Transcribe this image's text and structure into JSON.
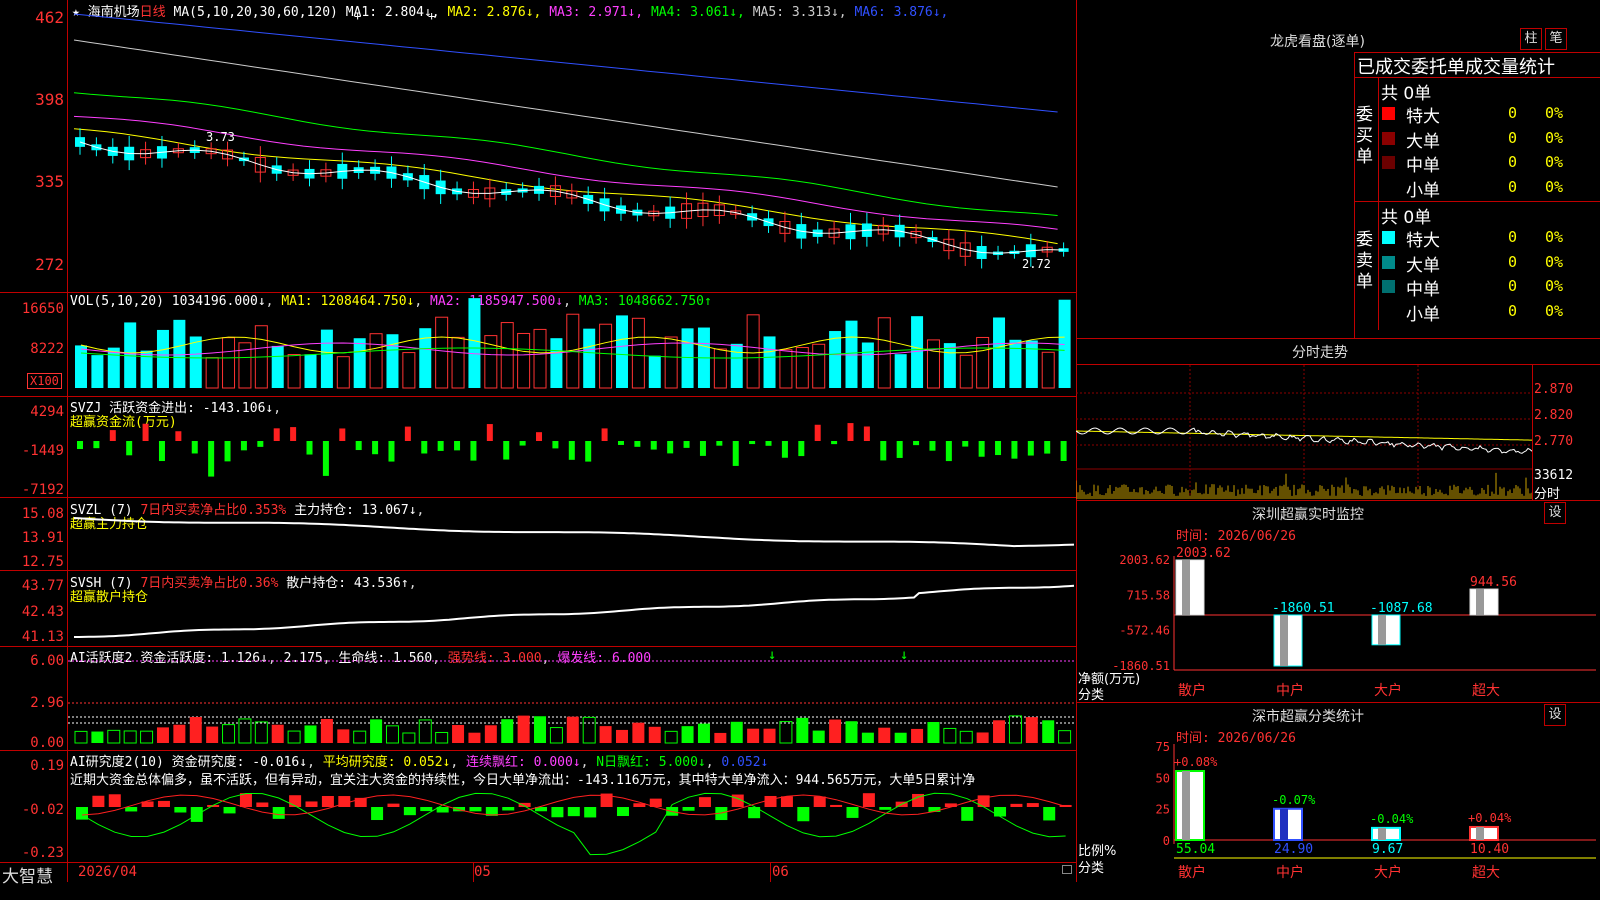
{
  "stock": {
    "name": "海南机场",
    "period": "日线",
    "star": "★"
  },
  "main_chart": {
    "ma_label": "MA(5,10,20,30,60,120)",
    "ma": [
      {
        "name": "MA1:",
        "value": "2.804↓",
        "color": "#ffffff"
      },
      {
        "name": "MA2:",
        "value": "2.876↓",
        "color": "#ffff00"
      },
      {
        "name": "MA3:",
        "value": "2.971↓",
        "color": "#ff40ff"
      },
      {
        "name": "MA4:",
        "value": "3.061↓",
        "color": "#00ff00"
      },
      {
        "name": "MA5:",
        "value": "3.313↓",
        "color": "#cccccc"
      },
      {
        "name": "MA6:",
        "value": "3.876↓",
        "color": "#3050ff"
      }
    ],
    "y_ticks": [
      "462",
      "398",
      "335",
      "272"
    ],
    "high_label": "3.73",
    "low_label": "2.72"
  },
  "vol_chart": {
    "label": "VOL(5,10,20)",
    "value": "1034196.000↓",
    "ma1": "MA1: 1208464.750↓",
    "ma2": "MA2: 1185947.500↓",
    "ma3": "MA3: 1048662.750↑",
    "y_ticks": [
      "16650",
      "8222"
    ],
    "unit": "X100"
  },
  "svzj": {
    "label": "SVZJ",
    "title": "活跃资金进出:",
    "value": "-143.106↓",
    "sub": "超赢资金流(万元)",
    "y_ticks": [
      "4294",
      "-1449",
      "-7192"
    ]
  },
  "svzl": {
    "label": "SVZL (7)",
    "title": "7日内买卖净占比0.353%",
    "main": "主力持仓: 13.067↓",
    "sub": "超赢主力持仓",
    "y_ticks": [
      "15.08",
      "13.91",
      "12.75"
    ]
  },
  "svsh": {
    "label": "SVSH (7)",
    "title": "7日内买卖净占比0.36%",
    "main": "散户持仓: 43.536↑",
    "sub": "超赢散户持仓",
    "y_ticks": [
      "43.77",
      "42.43",
      "41.13"
    ]
  },
  "ai_active": {
    "label": "AI活跃度2",
    "a": "资金活跃度: 1.126↓",
    "b": "2.175",
    "c": "生命线: 1.560",
    "d": "强势线: 3.000",
    "e": "爆发线: 6.000",
    "y_ticks": [
      "6.00",
      "2.96",
      "0.00"
    ]
  },
  "ai_research": {
    "label": "AI研究度2(10)",
    "a": "资金研究度: -0.016↓",
    "b": "平均研究度: 0.052↓",
    "c": "连续飘红: 0.000↓",
    "d": "N日飘红: 5.000↓",
    "e": "0.052↓",
    "note": "近期大资金总体偏多，虽不活跃，但有异动，宜关注大资金的持续性，今日大单净流出：-143.116万元，其中特大单净流入：944.565万元，大单5日累计净",
    "y_ticks": [
      "0.19",
      "-0.02",
      "-0.23"
    ]
  },
  "bottom": {
    "brand": "大智慧",
    "date": "2026/04",
    "m1": "05",
    "m2": "06"
  },
  "dragon": {
    "title": "龙虎看盘(逐单)",
    "btn1": "柱",
    "btn2": "笔",
    "header": "已成交委托单成交量统计",
    "buy": {
      "side": "委买单",
      "total": "共 0单",
      "rows": [
        {
          "name": "特大",
          "count": "0",
          "pct": "0%",
          "color": "#ff0000"
        },
        {
          "name": "大单",
          "count": "0",
          "pct": "0%",
          "color": "#8b0000"
        },
        {
          "name": "中单",
          "count": "0",
          "pct": "0%",
          "color": "#6b0000"
        },
        {
          "name": "小单",
          "count": "0",
          "pct": "0%",
          "color": ""
        }
      ]
    },
    "sell": {
      "side": "委卖单",
      "total": "共 0单",
      "rows": [
        {
          "name": "特大",
          "count": "0",
          "pct": "0%",
          "color": "#00ffff"
        },
        {
          "name": "大单",
          "count": "0",
          "pct": "0%",
          "color": "#008b8b"
        },
        {
          "name": "中单",
          "count": "0",
          "pct": "0%",
          "color": "#007070"
        },
        {
          "name": "小单",
          "count": "0",
          "pct": "0%",
          "color": ""
        }
      ]
    }
  },
  "intraday": {
    "title": "分时走势",
    "y_ticks": [
      "2.870",
      "2.820",
      "2.770"
    ],
    "vol": "33612",
    "unit": "分时"
  },
  "monitor": {
    "title": "深圳超赢实时监控",
    "btn": "设",
    "time": "时间: 2026/06/26",
    "y_ticks": [
      "2003.62",
      "715.58",
      "-572.46",
      "-1860.51"
    ],
    "ylab1": "净额(万元)",
    "ylab2": "分类",
    "bars": [
      {
        "cat": "散户",
        "value": 2003.62,
        "label": "2003.62"
      },
      {
        "cat": "中户",
        "value": -1860.51,
        "label": "-1860.51"
      },
      {
        "cat": "大户",
        "value": -1087.68,
        "label": "-1087.68"
      },
      {
        "cat": "超大",
        "value": 944.56,
        "label": "944.56"
      }
    ]
  },
  "classify": {
    "title": "深市超赢分类统计",
    "btn": "设",
    "time": "时间: 2026/06/26",
    "y_ticks": [
      "75",
      "50",
      "25",
      "0"
    ],
    "ylab1": "比例%",
    "ylab2": "分类",
    "bars": [
      {
        "cat": "散户",
        "value": 55.04,
        "label": "55.04",
        "chg": "+0.08%"
      },
      {
        "cat": "中户",
        "value": 24.9,
        "label": "24.90",
        "chg": "-0.07%"
      },
      {
        "cat": "大户",
        "value": 9.67,
        "label": "9.67",
        "chg": "-0.04%"
      },
      {
        "cat": "超大",
        "value": 10.4,
        "label": "10.40",
        "chg": "+0.04%"
      }
    ]
  }
}
